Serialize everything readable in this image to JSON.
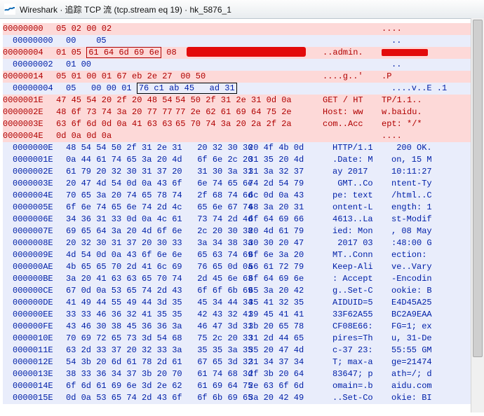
{
  "window": {
    "title": "Wireshark · 追踪 TCP 流 (tcp.stream eq 19) · hk_5876_1"
  },
  "rows": [
    {
      "cls": "clr-red",
      "addr": "00000000",
      "hex1": "05 02 00 02",
      "hex2": "",
      "a1": "",
      "a2": "...."
    },
    {
      "cls": "clr-blue",
      "pad": true,
      "addr": "00000000",
      "hex1": "00    05",
      "hex2": "",
      "a1": "",
      "a2": ".."
    },
    {
      "cls": "clr-red",
      "addr": "00000004",
      "hex1": "01 05 ",
      "box": "61 64 6d 69 6e",
      "mid": " 08  ",
      "cens": true,
      "a1": "..admin.",
      "a2": "",
      "cens2": true
    },
    {
      "cls": "clr-blue",
      "pad": true,
      "addr": "00000002",
      "hex1": "01 00",
      "hex2": "",
      "a1": "",
      "a2": ".."
    },
    {
      "cls": "clr-red",
      "addr": "00000014",
      "hex1": "05 01 00 01 67 eb 2e 27",
      "hex2": " 00 50",
      "a1": "....g..'",
      "a2": ".P"
    },
    {
      "cls": "clr-blue",
      "pad": true,
      "addr": "00000004",
      "hex1": "05   00 00 01 ",
      "box": "76 c1 ab 45   ad 31",
      "blue": true,
      "a1": "",
      "a2": "....v..E .1"
    },
    {
      "cls": "clr-red",
      "addr": "0000001E",
      "hex1": "47 45 54 20 2f 20 48 54",
      "hex2": "54 50 2f 31 2e 31 0d 0a",
      "a1": "GET / HT",
      "a2": "TP/1.1.."
    },
    {
      "cls": "clr-red",
      "addr": "0000002E",
      "hex1": "48 6f 73 74 3a 20 77 77",
      "hex2": "77 2e 62 61 69 64 75 2e",
      "a1": "Host: ww",
      "a2": "w.baidu."
    },
    {
      "cls": "clr-red",
      "addr": "0000003E",
      "hex1": "63 6f 6d 0d 0a 41 63 63",
      "hex2": "65 70 74 3a 20 2a 2f 2a",
      "a1": "com..Acc",
      "a2": "ept: */*"
    },
    {
      "cls": "clr-red",
      "addr": "0000004E",
      "hex1": "0d 0a 0d 0a",
      "hex2": "",
      "a1": "",
      "a2": "...."
    },
    {
      "cls": "clr-blue",
      "pad": true,
      "w12": true,
      "addr": "0000000E",
      "hex1": "48 54 54 50 2f 31 2e 31   20 32 30 30",
      "hex2": "20 4f 4b 0d",
      "a1": "HTTP/1.1",
      "a2": " 200 OK."
    },
    {
      "cls": "clr-blue",
      "pad": true,
      "w12": true,
      "addr": "0000001E",
      "hex1": "0a 44 61 74 65 3a 20 4d   6f 6e 2c 20",
      "hex2": "31 35 20 4d",
      "a1": ".Date: M",
      "a2": "on, 15 M"
    },
    {
      "cls": "clr-blue",
      "pad": true,
      "w12": true,
      "addr": "0000002E",
      "hex1": "61 79 20 32 30 31 37 20   31 30 3a 31",
      "hex2": "31 3a 32 37",
      "a1": "ay 2017 ",
      "a2": "10:11:27"
    },
    {
      "cls": "clr-blue",
      "pad": true,
      "w12": true,
      "addr": "0000003E",
      "hex1": "20 47 4d 54 0d 0a 43 6f   6e 74 65 6e",
      "hex2": "74 2d 54 79",
      "a1": " GMT..Co",
      "a2": "ntent-Ty"
    },
    {
      "cls": "clr-blue",
      "pad": true,
      "w12": true,
      "addr": "0000004E",
      "hex1": "70 65 3a 20 74 65 78 74   2f 68 74 6d",
      "hex2": "6c 0d 0a 43",
      "a1": "pe: text",
      "a2": "/html..C"
    },
    {
      "cls": "clr-blue",
      "pad": true,
      "w12": true,
      "addr": "0000005E",
      "hex1": "6f 6e 74 65 6e 74 2d 4c   65 6e 67 74",
      "hex2": "68 3a 20 31",
      "a1": "ontent-L",
      "a2": "ength: 1"
    },
    {
      "cls": "clr-blue",
      "pad": true,
      "w12": true,
      "addr": "0000006E",
      "hex1": "34 36 31 33 0d 0a 4c 61   73 74 2d 4d",
      "hex2": "6f 64 69 66",
      "a1": "4613..La",
      "a2": "st-Modif"
    },
    {
      "cls": "clr-blue",
      "pad": true,
      "w12": true,
      "addr": "0000007E",
      "hex1": "69 65 64 3a 20 4d 6f 6e   2c 20 30 38",
      "hex2": "20 4d 61 79",
      "a1": "ied: Mon",
      "a2": ", 08 May"
    },
    {
      "cls": "clr-blue",
      "pad": true,
      "w12": true,
      "addr": "0000008E",
      "hex1": "20 32 30 31 37 20 30 33   3a 34 38 3a",
      "hex2": "30 30 20 47",
      "a1": " 2017 03",
      "a2": ":48:00 G"
    },
    {
      "cls": "clr-blue",
      "pad": true,
      "w12": true,
      "addr": "0000009E",
      "hex1": "4d 54 0d 0a 43 6f 6e 6e   65 63 74 69",
      "hex2": "6f 6e 3a 20",
      "a1": "MT..Conn",
      "a2": "ection: "
    },
    {
      "cls": "clr-blue",
      "pad": true,
      "w12": true,
      "addr": "000000AE",
      "hex1": "4b 65 65 70 2d 41 6c 69   76 65 0d 0a",
      "hex2": "56 61 72 79",
      "a1": "Keep-Ali",
      "a2": "ve..Vary"
    },
    {
      "cls": "clr-blue",
      "pad": true,
      "w12": true,
      "addr": "000000BE",
      "hex1": "3a 20 41 63 63 65 70 74   2d 45 6e 63",
      "hex2": "6f 64 69 6e",
      "a1": ": Accept",
      "a2": "-Encodin"
    },
    {
      "cls": "clr-blue",
      "pad": true,
      "w12": true,
      "addr": "000000CE",
      "hex1": "67 0d 0a 53 65 74 2d 43   6f 6f 6b 69",
      "hex2": "65 3a 20 42",
      "a1": "g..Set-C",
      "a2": "ookie: B"
    },
    {
      "cls": "clr-blue",
      "pad": true,
      "w12": true,
      "addr": "000000DE",
      "hex1": "41 49 44 55 49 44 3d 35   45 34 44 34",
      "hex2": "35 41 32 35",
      "a1": "AIDUID=5",
      "a2": "E4D45A25"
    },
    {
      "cls": "clr-blue",
      "pad": true,
      "w12": true,
      "addr": "000000EE",
      "hex1": "33 33 46 36 32 41 35 35   42 43 32 41",
      "hex2": "39 45 41 41",
      "a1": "33F62A55",
      "a2": "BC2A9EAA"
    },
    {
      "cls": "clr-blue",
      "pad": true,
      "w12": true,
      "addr": "000000FE",
      "hex1": "43 46 30 38 45 36 36 3a   46 47 3d 31",
      "hex2": "3b 20 65 78",
      "a1": "CF08E66:",
      "a2": "FG=1; ex"
    },
    {
      "cls": "clr-blue",
      "pad": true,
      "w12": true,
      "addr": "0000010E",
      "hex1": "70 69 72 65 73 3d 54 68   75 2c 20 33",
      "hex2": "31 2d 44 65",
      "a1": "pires=Th",
      "a2": "u, 31-De"
    },
    {
      "cls": "clr-blue",
      "pad": true,
      "w12": true,
      "addr": "0000011E",
      "hex1": "63 2d 33 37 20 32 33 3a   35 35 3a 35",
      "hex2": "35 20 47 4d",
      "a1": "c-37 23:",
      "a2": "55:55 GM"
    },
    {
      "cls": "clr-blue",
      "pad": true,
      "w12": true,
      "addr": "0000012E",
      "hex1": "54 3b 20 6d 61 78 2d 61   67 65 3d 32",
      "hex2": "31 34 37 34",
      "a1": "T; max-a",
      "a2": "ge=21474"
    },
    {
      "cls": "clr-blue",
      "pad": true,
      "w12": true,
      "addr": "0000013E",
      "hex1": "38 33 36 34 37 3b 20 70   61 74 68 3d",
      "hex2": "2f 3b 20 64",
      "a1": "83647; p",
      "a2": "ath=/; d"
    },
    {
      "cls": "clr-blue",
      "pad": true,
      "w12": true,
      "addr": "0000014E",
      "hex1": "6f 6d 61 69 6e 3d 2e 62   61 69 64 75",
      "hex2": "2e 63 6f 6d",
      "a1": "omain=.b",
      "a2": "aidu.com"
    },
    {
      "cls": "clr-blue",
      "pad": true,
      "w12": true,
      "addr": "0000015E",
      "hex1": "0d 0a 53 65 74 2d 43 6f   6f 6b 69 65",
      "hex2": "3a 20 42 49",
      "a1": "..Set-Co",
      "a2": "okie: BI"
    }
  ]
}
